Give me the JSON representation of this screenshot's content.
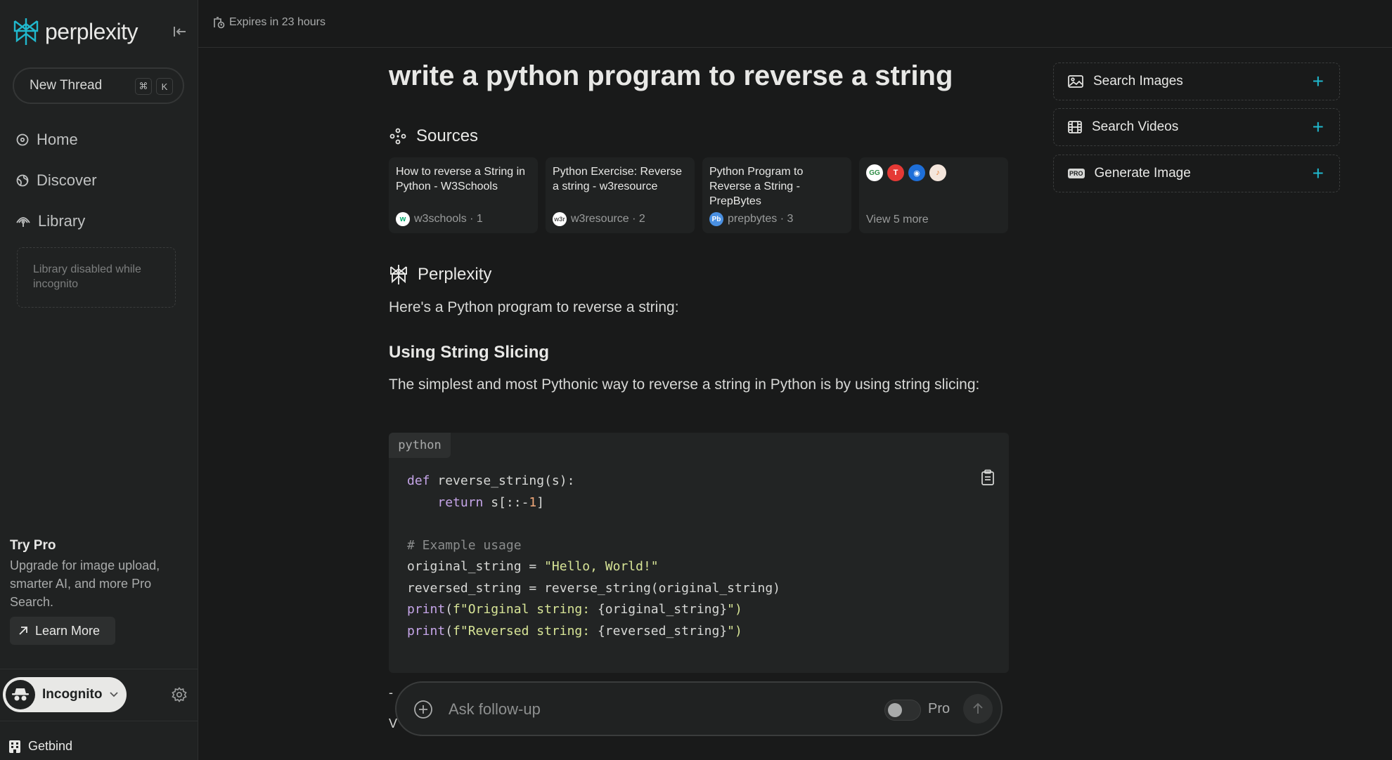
{
  "app": {
    "name": "perplexity"
  },
  "sidebar": {
    "new_thread": {
      "label": "New Thread",
      "kbd": [
        "⌘",
        "K"
      ]
    },
    "nav": [
      {
        "label": "Home",
        "icon": "home-icon"
      },
      {
        "label": "Discover",
        "icon": "globe-icon"
      },
      {
        "label": "Library",
        "icon": "library-icon"
      }
    ],
    "library_disabled": "Library disabled while incognito",
    "try_pro": {
      "title": "Try Pro",
      "text": "Upgrade for image upload, smarter AI, and more Pro Search.",
      "button": "Learn More"
    },
    "account": {
      "label": "Incognito"
    },
    "workspace": {
      "label": "Getbind"
    }
  },
  "topbar": {
    "expires": "Expires in 23 hours"
  },
  "thread": {
    "query": "write a python program to reverse a string",
    "sources_heading": "Sources",
    "sources": [
      {
        "title": "How to reverse a String in Python - W3Schools",
        "site": "w3schools",
        "index": "1",
        "fav_color": "#ffffff"
      },
      {
        "title": "Python Exercise: Reverse a string - w3resource",
        "site": "w3resource",
        "index": "2",
        "fav_color": "#ffffff"
      },
      {
        "title": "Python Program to Reverse a String - PrepBytes",
        "site": "prepbytes",
        "index": "3",
        "fav_color": "#4a90e2"
      }
    ],
    "view_more": "View 5 more",
    "answer_heading": "Perplexity",
    "intro": "Here's a Python program to reverse a string:",
    "subheading": "Using String Slicing",
    "paragraph": "The simplest and most Pythonic way to reverse a string in Python is by using string slicing:",
    "code_lang": "python",
    "code_lines": {
      "l1_def": "def",
      "l1_rest": " reverse_string(s):",
      "l2_kw": "return",
      "l2_a": " s[::-",
      "l2_num": "1",
      "l2_b": "]",
      "l4": "# Example usage",
      "l5_a": "original_string = ",
      "l5_str": "\"Hello, World!\"",
      "l6": "reversed_string = reverse_string(original_string)",
      "l7_fn": "print",
      "l7_a": "(",
      "l7_str": "f\"Original string: ",
      "l7_b": "{original_string}",
      "l7_end": "\")",
      "l8_fn": "print",
      "l8_a": "(",
      "l8_str": "f\"Reversed string: ",
      "l8_b": "{reversed_string}",
      "l8_end": "\")"
    },
    "frag_1": "-",
    "frag_2": "V"
  },
  "followup": {
    "placeholder": "Ask follow-up",
    "pro_label": "Pro",
    "pro_enabled": false
  },
  "right_panel": [
    {
      "label": "Search Images",
      "icon": "image-icon"
    },
    {
      "label": "Search Videos",
      "icon": "video-icon"
    },
    {
      "label": "Generate Image",
      "icon": "pro-badge-icon",
      "badge": "PRO"
    }
  ],
  "colors": {
    "accent": "#20b8cd",
    "background": "#191a1a",
    "sidebar": "#202222"
  }
}
